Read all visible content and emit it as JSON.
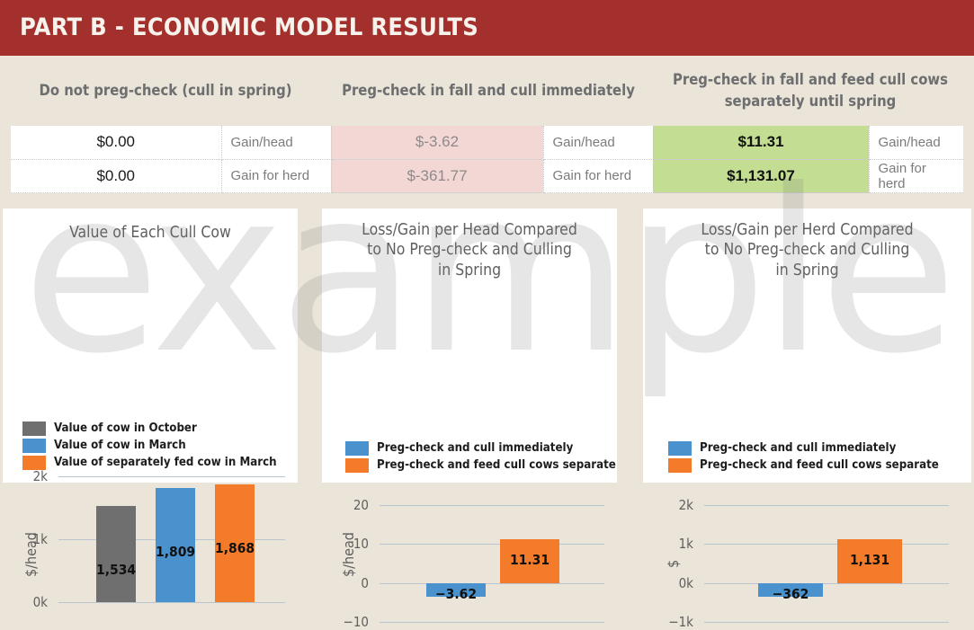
{
  "header": {
    "title": "PART B - ECONOMIC MODEL RESULTS",
    "background_color": "#a3302c",
    "text_color": "#f7f2ec"
  },
  "page": {
    "background_color": "#ebe4d8",
    "watermark_text": "example"
  },
  "columns": [
    {
      "label": "Do not preg-check (cull in spring)"
    },
    {
      "label": "Preg-check in fall and cull immediately"
    },
    {
      "label": "Preg-check in fall and feed cull cows separately until spring"
    }
  ],
  "table": {
    "rows": [
      {
        "baseline_value": "$0.00",
        "baseline_label": "Gain/head",
        "cull_now_value": "$-3.62",
        "cull_now_label": "Gain/head",
        "feed_separate_value": "$11.31",
        "feed_separate_label": "Gain/head"
      },
      {
        "baseline_value": "$0.00",
        "baseline_label": "Gain for herd",
        "cull_now_value": "$-361.77",
        "cull_now_label": "Gain for herd",
        "feed_separate_value": "$1,131.07",
        "feed_separate_label": "Gain for herd"
      }
    ],
    "negative_cell_color": "#f2d7d5",
    "positive_cell_color": "#c3de93"
  },
  "colors": {
    "gray": "#6f6f6f",
    "blue": "#4a92ce",
    "orange": "#f47b2a",
    "gridline": "#b8c4cf",
    "axis_text": "#5f5f5f"
  },
  "chart_data": [
    {
      "type": "bar",
      "title": "Value of Each Cull Cow",
      "xlabel": "",
      "ylabel": "$/head",
      "ylim": [
        0,
        2000
      ],
      "yticks": [
        0,
        1000,
        2000
      ],
      "ytick_labels": [
        "0k",
        "1k",
        "2k"
      ],
      "grid": true,
      "legend_position": "bottom-left",
      "categories": [
        "Value of cow in October",
        "Value of cow in March",
        "Value of separately fed cow in March"
      ],
      "values": [
        1534,
        1809,
        1868
      ],
      "data_labels": [
        "1,534",
        "1,809",
        "1,868"
      ],
      "bar_colors": [
        "#6f6f6f",
        "#4a92ce",
        "#f47b2a"
      ],
      "legend": [
        {
          "label": "Value of cow in October",
          "color": "#6f6f6f"
        },
        {
          "label": "Value of cow in March",
          "color": "#4a92ce"
        },
        {
          "label": "Value of separately fed cow in March",
          "color": "#f47b2a"
        }
      ]
    },
    {
      "type": "bar",
      "title": "Loss/Gain per Head Compared to No Preg-check and Culling in Spring",
      "title_lines": [
        "Loss/Gain per Head Compared",
        "to No Preg-check and Culling",
        "in Spring"
      ],
      "xlabel": "",
      "ylabel": "$/head",
      "ylim": [
        -10,
        20
      ],
      "yticks": [
        -10,
        0,
        10,
        20
      ],
      "ytick_labels": [
        "−10",
        "0",
        "10",
        "20"
      ],
      "grid": true,
      "legend_position": "bottom-left",
      "categories": [
        "Preg-check and cull immediately",
        "Preg-check and feed cull cows separate"
      ],
      "values": [
        -3.62,
        11.31
      ],
      "data_labels": [
        "−3.62",
        "11.31"
      ],
      "bar_colors": [
        "#4a92ce",
        "#f47b2a"
      ],
      "legend": [
        {
          "label": "Preg-check and cull immediately",
          "color": "#4a92ce"
        },
        {
          "label": "Preg-check and feed cull cows separate",
          "color": "#f47b2a"
        }
      ]
    },
    {
      "type": "bar",
      "title": "Loss/Gain per Herd Compared to No Preg-check and Culling in Spring",
      "title_lines": [
        "Loss/Gain per Herd Compared",
        "to No Preg-check and Culling",
        "in Spring"
      ],
      "xlabel": "",
      "ylabel": "$",
      "ylim": [
        -1000,
        2000
      ],
      "yticks": [
        -1000,
        0,
        1000,
        2000
      ],
      "ytick_labels": [
        "−1k",
        "0k",
        "1k",
        "2k"
      ],
      "grid": true,
      "legend_position": "bottom-left",
      "categories": [
        "Preg-check and cull immediately",
        "Preg-check and feed cull cows separate"
      ],
      "values": [
        -362,
        1131
      ],
      "data_labels": [
        "−362",
        "1,131"
      ],
      "bar_colors": [
        "#4a92ce",
        "#f47b2a"
      ],
      "legend": [
        {
          "label": "Preg-check and cull immediately",
          "color": "#4a92ce"
        },
        {
          "label": "Preg-check and feed cull cows separate",
          "color": "#f47b2a"
        }
      ]
    }
  ]
}
